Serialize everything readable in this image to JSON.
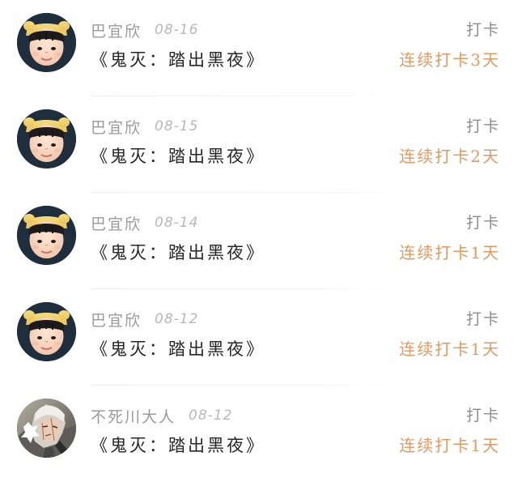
{
  "feed": {
    "items": [
      {
        "username": "巴宜欣",
        "date": "08-16",
        "title": "《鬼灭：踏出黑夜》",
        "action_label": "打卡",
        "streak_text": "连续打卡3天",
        "avatar": "toddler-yellow-hat-avatar"
      },
      {
        "username": "巴宜欣",
        "date": "08-15",
        "title": "《鬼灭：踏出黑夜》",
        "action_label": "打卡",
        "streak_text": "连续打卡2天",
        "avatar": "toddler-yellow-hat-avatar"
      },
      {
        "username": "巴宜欣",
        "date": "08-14",
        "title": "《鬼灭：踏出黑夜》",
        "action_label": "打卡",
        "streak_text": "连续打卡1天",
        "avatar": "toddler-yellow-hat-avatar"
      },
      {
        "username": "巴宜欣",
        "date": "08-12",
        "title": "《鬼灭：踏出黑夜》",
        "action_label": "打卡",
        "streak_text": "连续打卡1天",
        "avatar": "toddler-yellow-hat-avatar"
      },
      {
        "username": "不死川大人",
        "date": "08-12",
        "title": "《鬼灭：踏出黑夜》",
        "action_label": "打卡",
        "streak_text": "连续打卡1天",
        "avatar": "anime-character-avatar"
      }
    ]
  },
  "colors": {
    "username": "#9a9a9a",
    "date": "#b8b8b8",
    "title": "#262626",
    "action": "#8d8d8d",
    "streak": "#e09a61",
    "divider": "#ececec"
  }
}
